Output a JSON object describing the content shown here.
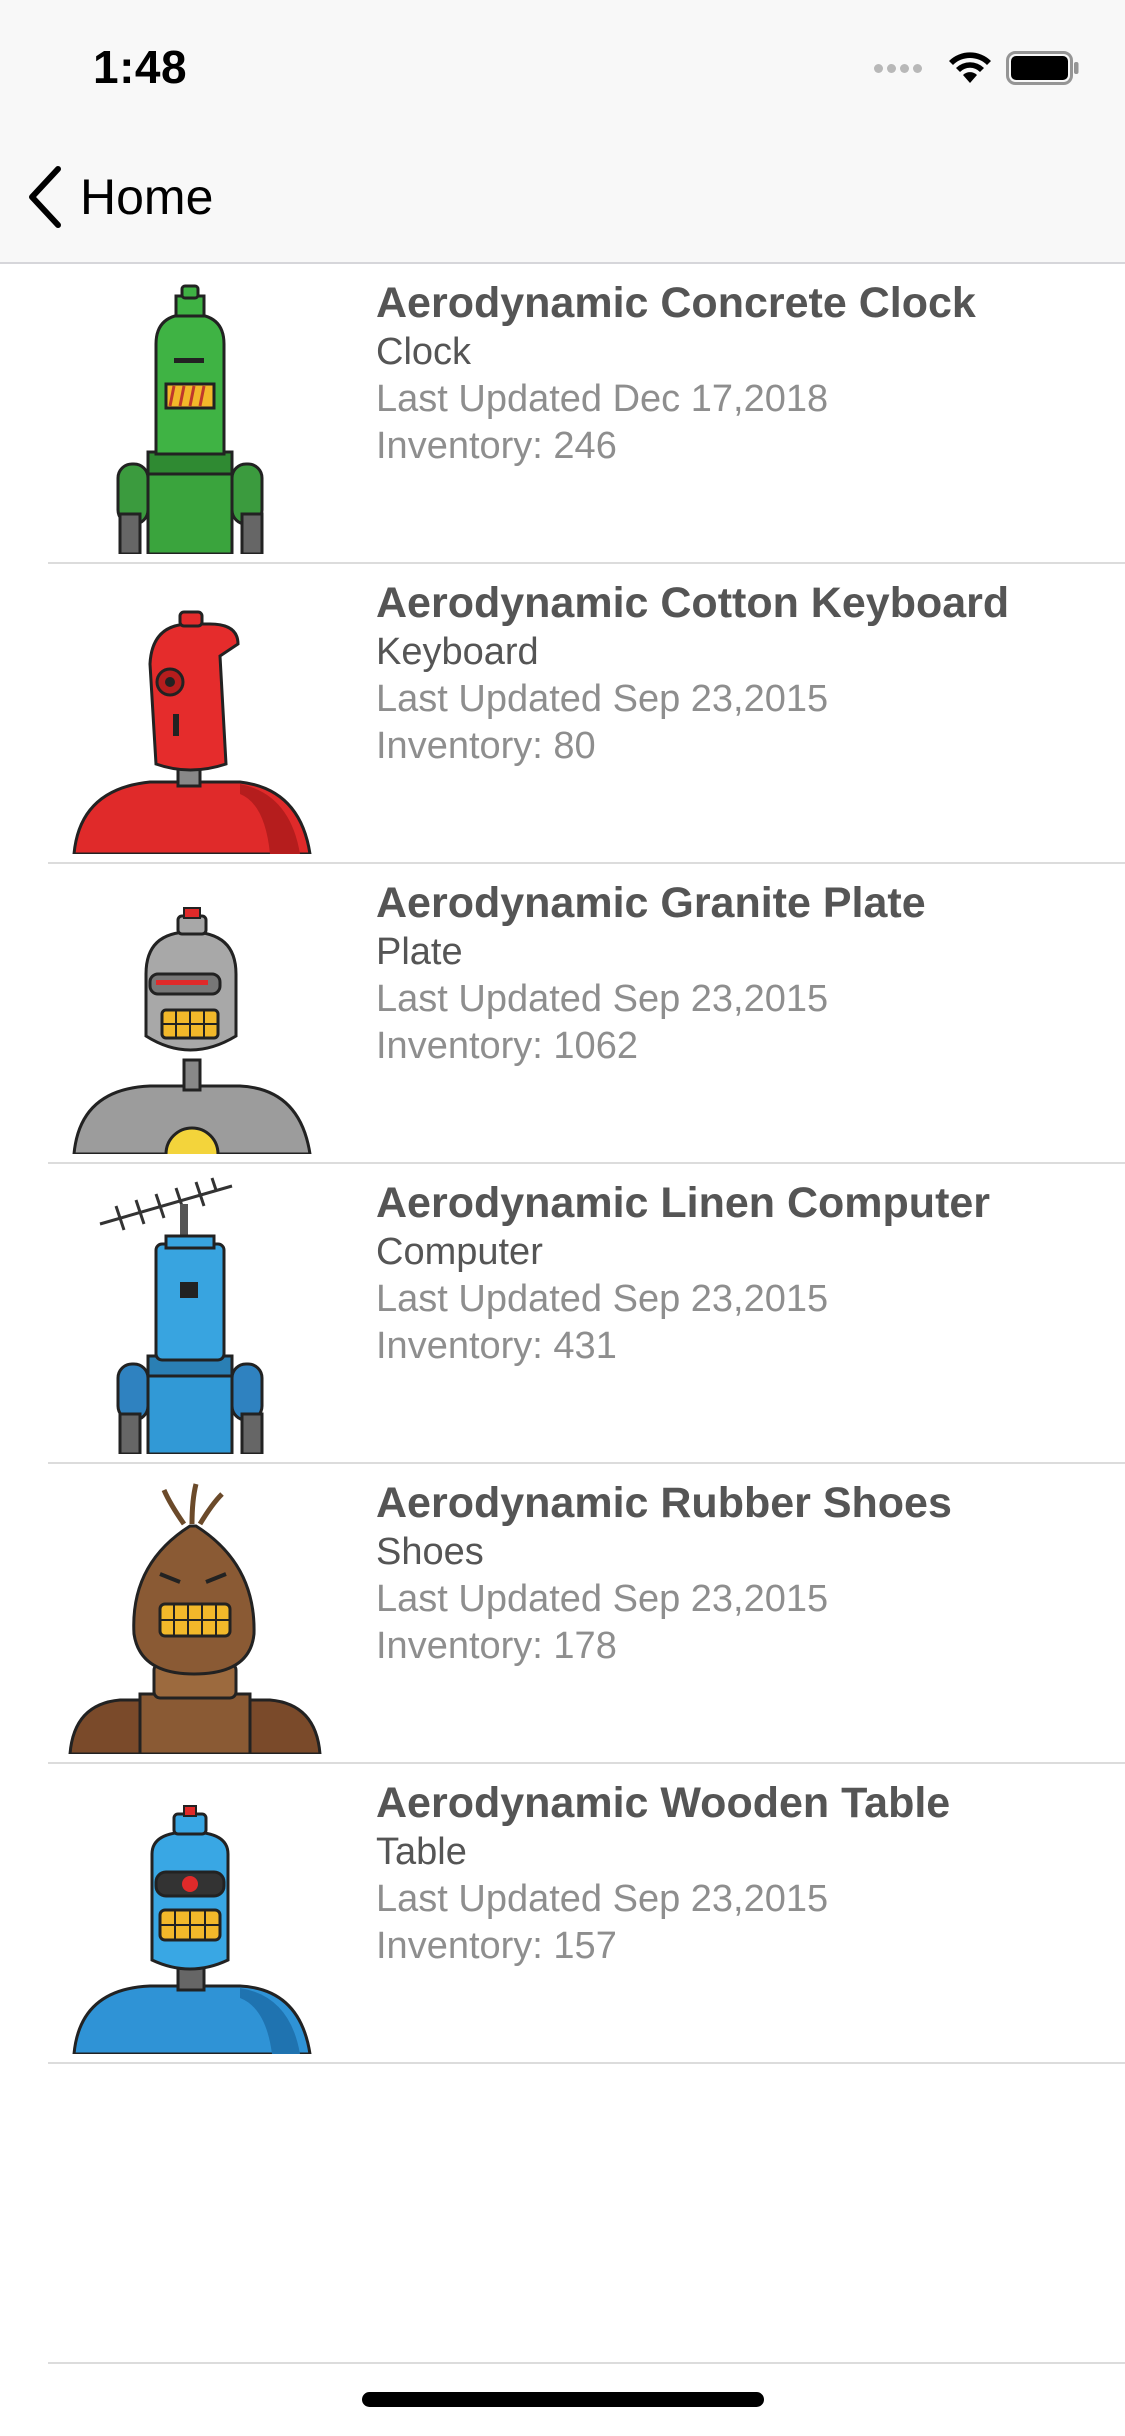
{
  "status_bar": {
    "time": "1:48"
  },
  "nav": {
    "back_label": "Home"
  },
  "colors": {
    "nav_background": "#f8f8f8",
    "title_text": "#555555",
    "secondary_text": "#8e8e8e",
    "separator": "#dcdcdc"
  },
  "products": [
    {
      "name": "Aerodynamic Concrete Clock",
      "category": "Clock",
      "updated": "Last Updated Dec 17,2018",
      "inventory": "Inventory: 246",
      "icon": "green-robot-icon"
    },
    {
      "name": "Aerodynamic Cotton Keyboard",
      "category": "Keyboard",
      "updated": "Last Updated Sep 23,2015",
      "inventory": "Inventory: 80",
      "icon": "red-robot-icon"
    },
    {
      "name": "Aerodynamic Granite Plate",
      "category": "Plate",
      "updated": "Last Updated Sep 23,2015",
      "inventory": "Inventory: 1062",
      "icon": "gray-robot-icon"
    },
    {
      "name": "Aerodynamic Linen Computer",
      "category": "Computer",
      "updated": "Last Updated Sep 23,2015",
      "inventory": "Inventory: 431",
      "icon": "blue-antenna-robot-icon"
    },
    {
      "name": "Aerodynamic Rubber Shoes",
      "category": "Shoes",
      "updated": "Last Updated Sep 23,2015",
      "inventory": "Inventory: 178",
      "icon": "brown-robot-icon"
    },
    {
      "name": "Aerodynamic Wooden Table",
      "category": "Table",
      "updated": "Last Updated Sep 23,2015",
      "inventory": "Inventory: 157",
      "icon": "blue-robot-icon"
    }
  ]
}
